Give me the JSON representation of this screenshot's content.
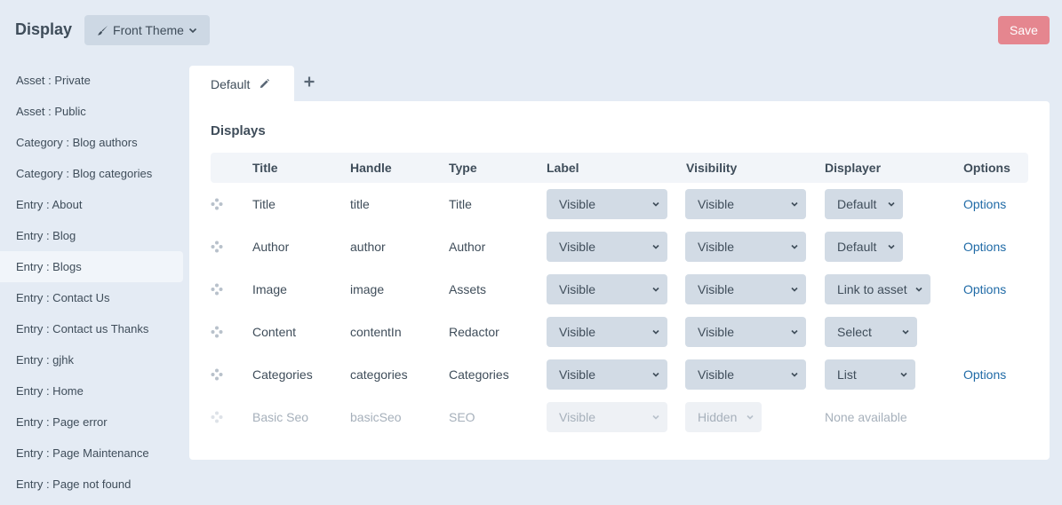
{
  "header": {
    "title": "Display",
    "theme_button": "Front Theme",
    "save_button": "Save"
  },
  "sidebar": {
    "items": [
      {
        "label": "Asset : Private"
      },
      {
        "label": "Asset : Public"
      },
      {
        "label": "Category : Blog authors"
      },
      {
        "label": "Category : Blog categories"
      },
      {
        "label": "Entry : About"
      },
      {
        "label": "Entry : Blog"
      },
      {
        "label": "Entry : Blogs",
        "active": true
      },
      {
        "label": "Entry : Contact Us"
      },
      {
        "label": "Entry : Contact us Thanks"
      },
      {
        "label": "Entry : gjhk"
      },
      {
        "label": "Entry : Home"
      },
      {
        "label": "Entry : Page error"
      },
      {
        "label": "Entry : Page Maintenance"
      },
      {
        "label": "Entry : Page not found"
      }
    ]
  },
  "tabs": {
    "active_tab": "Default"
  },
  "displays": {
    "heading": "Displays",
    "columns": {
      "title": "Title",
      "handle": "Handle",
      "type": "Type",
      "label": "Label",
      "visibility": "Visibility",
      "displayer": "Displayer",
      "options": "Options"
    },
    "rows": [
      {
        "title": "Title",
        "handle": "title",
        "type": "Title",
        "label": "Visible",
        "visibility": "Visible",
        "displayer": "Default",
        "options": "Options"
      },
      {
        "title": "Author",
        "handle": "author",
        "type": "Author",
        "label": "Visible",
        "visibility": "Visible",
        "displayer": "Default",
        "options": "Options"
      },
      {
        "title": "Image",
        "handle": "image",
        "type": "Assets",
        "label": "Visible",
        "visibility": "Visible",
        "displayer": "Link to asset",
        "options": "Options"
      },
      {
        "title": "Content",
        "handle": "contentIn",
        "type": "Redactor",
        "label": "Visible",
        "visibility": "Visible",
        "displayer": "Select",
        "options": ""
      },
      {
        "title": "Categories",
        "handle": "categories",
        "type": "Categories",
        "label": "Visible",
        "visibility": "Visible",
        "displayer": "List",
        "options": "Options"
      },
      {
        "title": "Basic Seo",
        "handle": "basicSeo",
        "type": "SEO",
        "label": "Visible",
        "visibility": "Hidden",
        "displayer": "None available",
        "options": "",
        "disabled": true
      }
    ]
  },
  "colors": {
    "background": "#e4ebf4",
    "save": "#e5868f",
    "link": "#1f6aa6"
  }
}
